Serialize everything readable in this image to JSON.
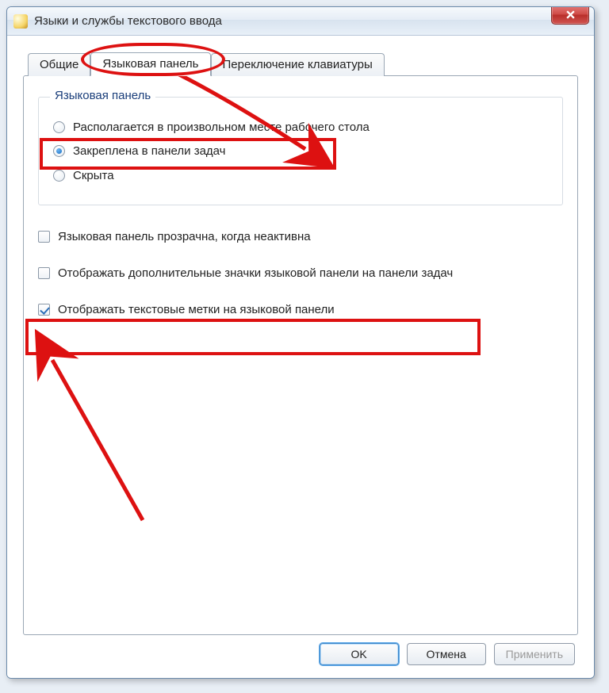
{
  "window": {
    "title": "Языки и службы текстового ввода"
  },
  "tabs": {
    "general": "Общие",
    "langbar": "Языковая панель",
    "switching": "Переключение клавиатуры",
    "active": "langbar"
  },
  "group": {
    "legend": "Языковая панель",
    "radio_float": "Располагается в произвольном месте рабочего стола",
    "radio_docked": "Закреплена в панели задач",
    "radio_hidden": "Скрыта",
    "selected": "docked"
  },
  "checks": {
    "transparent": {
      "label": "Языковая панель прозрачна, когда неактивна",
      "checked": false
    },
    "extra_icons": {
      "label": "Отображать дополнительные значки языковой панели на панели задач",
      "checked": false
    },
    "text_labels": {
      "label": "Отображать текстовые метки на языковой панели",
      "checked": true
    }
  },
  "buttons": {
    "ok": "OK",
    "cancel": "Отмена",
    "apply": "Применить"
  }
}
